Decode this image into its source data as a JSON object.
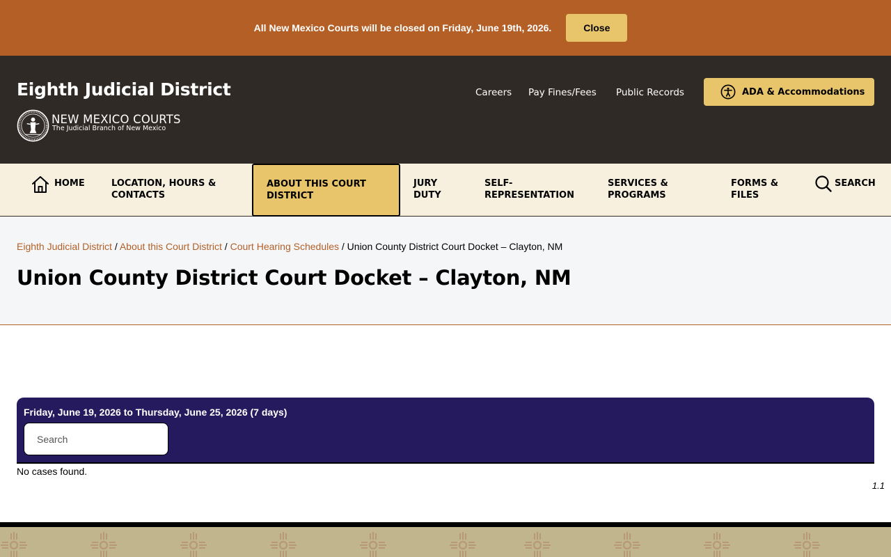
{
  "alert": {
    "message": "All New Mexico Courts will be closed on Friday, June 19th, 2026.",
    "close_label": "Close"
  },
  "header": {
    "site_title": "Eighth Judicial District",
    "brand_name": "NEW MEXICO COURTS",
    "brand_tagline": "The Judicial Branch of New Mexico",
    "utility_links": [
      "Careers",
      "Pay Fines/Fees",
      "Public Records"
    ],
    "ada_label": "ADA & Accommodations"
  },
  "nav": {
    "home": "HOME",
    "items": [
      "LOCATION, HOURS & CONTACTS",
      "ABOUT THIS COURT DISTRICT",
      "JURY DUTY",
      "SELF-REPRESENTATION",
      "SERVICES & PROGRAMS",
      "FORMS & FILES"
    ],
    "search": "SEARCH"
  },
  "breadcrumb": {
    "links": [
      "Eighth Judicial District",
      "About this Court District",
      "Court Hearing Schedules"
    ],
    "separator": " / ",
    "current": "Union County District Court Docket – Clayton, NM"
  },
  "page": {
    "title": "Union County District Court Docket – Clayton, NM"
  },
  "docket": {
    "range": "Friday, June 19, 2026 to Thursday, June 25, 2026 (7 days)",
    "search_placeholder": "Search",
    "empty_message": "No cases found.",
    "version": "1.1"
  },
  "colors": {
    "alert_bg": "#b35f26",
    "header_bg": "#302a26",
    "accent_gold": "#e8c46b",
    "nav_bg": "#f7f0df",
    "link": "#b35f26",
    "docket_bg": "#261a5e",
    "footer_bg": "#c0b58c"
  },
  "icons": {
    "home": "home-icon",
    "search": "search-icon",
    "accessibility": "accessibility-icon",
    "seal": "court-seal-logo",
    "footer_pattern": "zia-sun-symbol"
  }
}
